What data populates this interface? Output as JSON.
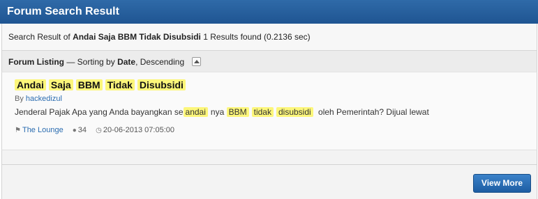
{
  "header": {
    "title": "Forum Search Result"
  },
  "summary": {
    "prefix": "Search Result of",
    "query": "Andai Saja BBM Tidak Disubsidi",
    "results_text": "1 Results found (0.2136 sec)"
  },
  "listing": {
    "label": "Forum Listing",
    "sort_prefix": "— Sorting by",
    "sort_field": "Date",
    "sort_order": ", Descending"
  },
  "result": {
    "title_words": [
      "Andai",
      "Saja",
      "BBM",
      "Tidak",
      "Disubsidi"
    ],
    "by_label": "By",
    "author": "hackedizul",
    "snippet": {
      "part1": "Jenderal Pajak Apa yang Anda bayangkan se",
      "hl1": "andai",
      "part2": "nya",
      "hl2": "BBM",
      "hl3": "tidak",
      "hl4": "disubsidi",
      "part3": "oleh Pemerintah? Dijual lewat"
    },
    "forum": "The Lounge",
    "replies": "34",
    "date": "20-06-2013 07:05:00"
  },
  "footer": {
    "view_more_label": "View More"
  },
  "icons": {
    "tag": "tag-icon",
    "comment": "comment-icon",
    "clock": "clock-icon",
    "collapse": "collapse-icon"
  }
}
